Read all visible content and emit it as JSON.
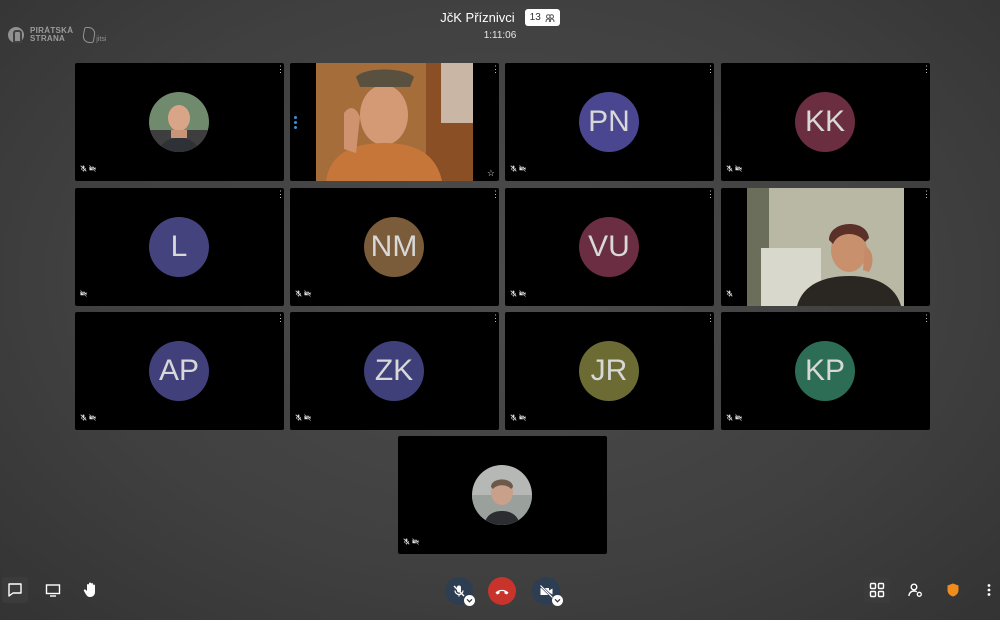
{
  "app": {
    "logo_text_line1": "PIRÁTSKÁ",
    "logo_text_line2": "STRANA",
    "jitsi_label": "jitsi"
  },
  "meeting": {
    "title": "JčK Příznivci",
    "participant_count": "13",
    "timer": "1:11:06"
  },
  "participants": [
    {
      "initials": "",
      "type": "photo",
      "audio_muted": true,
      "video_muted": true
    },
    {
      "initials": "",
      "type": "video",
      "audio_muted": false,
      "video_muted": false
    },
    {
      "initials": "PN",
      "type": "avatar",
      "color": "#4a4690",
      "audio_muted": true,
      "video_muted": true
    },
    {
      "initials": "KK",
      "type": "avatar",
      "color": "#6b2d40",
      "audio_muted": true,
      "video_muted": true
    },
    {
      "initials": "L",
      "type": "avatar",
      "color": "#45437e",
      "audio_muted": false,
      "video_muted": true
    },
    {
      "initials": "NM",
      "type": "avatar",
      "color": "#7b5c3a",
      "audio_muted": true,
      "video_muted": true
    },
    {
      "initials": "VU",
      "type": "avatar",
      "color": "#6a2d42",
      "audio_muted": true,
      "video_muted": true
    },
    {
      "initials": "",
      "type": "video",
      "audio_muted": true,
      "video_muted": false
    },
    {
      "initials": "AP",
      "type": "avatar",
      "color": "#42407a",
      "audio_muted": true,
      "video_muted": true
    },
    {
      "initials": "ZK",
      "type": "avatar",
      "color": "#3f4079",
      "audio_muted": true,
      "video_muted": true
    },
    {
      "initials": "JR",
      "type": "avatar",
      "color": "#6d6b34",
      "audio_muted": true,
      "video_muted": true
    },
    {
      "initials": "KP",
      "type": "avatar",
      "color": "#2d6c55",
      "audio_muted": true,
      "video_muted": true
    },
    {
      "initials": "",
      "type": "photo",
      "audio_muted": true,
      "video_muted": true
    }
  ],
  "toolbar": {
    "left": [
      "chat-icon",
      "screenshare-icon",
      "raise-hand-icon"
    ],
    "center": [
      "microphone-muted-icon",
      "hangup-icon",
      "camera-muted-icon"
    ],
    "right": [
      "tile-view-icon",
      "participants-icon",
      "security-shield-icon",
      "more-options-icon"
    ],
    "hangup_color": "#c8342b",
    "shield_color": "#f08b1d"
  }
}
